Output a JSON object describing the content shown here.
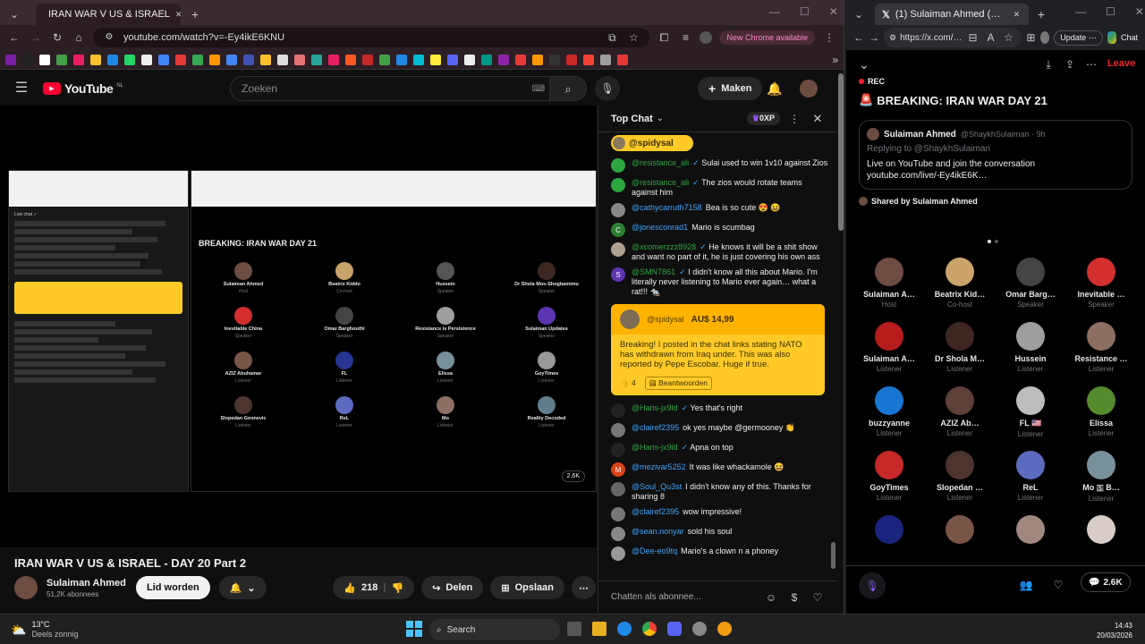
{
  "left_browser": {
    "tab_title": "IRAN WAR V US & ISRAEL",
    "url": "youtube.com/watch?v=-Ey4ikE6KNU",
    "chrome_banner": "New Chrome available"
  },
  "youtube": {
    "logo": "YouTube",
    "region": "NL",
    "search_placeholder": "Zoeken",
    "create_label": "Maken",
    "video_title": "IRAN WAR V US & ISRAEL - DAY 20 Part 2",
    "channel_name": "Sulaiman Ahmed",
    "subscribers": "51,2K abonnees",
    "join_label": "Lid worden",
    "likes": "218",
    "share_label": "Delen",
    "save_label": "Opslaan"
  },
  "video_inner": {
    "space_title": "BREAKING: IRAN WAR DAY 21",
    "speakers": [
      {
        "name": "Sulaiman Ahmed",
        "role": "Host"
      },
      {
        "name": "Beatrix Kiddo",
        "role": "Co-host"
      },
      {
        "name": "Hussein",
        "role": "Speaker"
      },
      {
        "name": "Dr Shola Mos-Shogbamimu",
        "role": "Speaker"
      },
      {
        "name": "Inevitable China",
        "role": "Speaker"
      },
      {
        "name": "Omar Barghouthi",
        "role": "Speaker"
      },
      {
        "name": "Resistance is Persistence",
        "role": "Speaker"
      },
      {
        "name": "Sulaiman Updates",
        "role": "Speaker"
      },
      {
        "name": "AZIZ Abuhamar",
        "role": "Listener"
      },
      {
        "name": "FL",
        "role": "Listener"
      },
      {
        "name": "Elissa",
        "role": "Listener"
      },
      {
        "name": "GoyTimes",
        "role": "Listener"
      },
      {
        "name": "Slopedan Geonevic",
        "role": "Listener"
      },
      {
        "name": "ReL",
        "role": "Listener"
      },
      {
        "name": "Mo",
        "role": "Listener"
      },
      {
        "name": "Reality Decoded",
        "role": "Listener"
      }
    ],
    "listeners_count": "2.6K"
  },
  "chat": {
    "mode": "Top Chat",
    "xp": "0XP",
    "pinned_user": "@spidysal",
    "messages_top": [
      {
        "user": "@resistance_ali",
        "text": "Sulai used to win 1v10 against Zios",
        "verified": true,
        "color": "#2ba640"
      },
      {
        "user": "@resistance_ali",
        "text": "The zios would rotate teams against him",
        "verified": true,
        "color": "#2ba640"
      },
      {
        "user": "@cathycarruth7158",
        "text": "Bea is so cute 😍 😆",
        "verified": false,
        "color": "#888"
      },
      {
        "user": "@jonesconrad1",
        "text": "Mario is scumbag",
        "verified": false,
        "color": "#2e7d32",
        "initial": "C"
      },
      {
        "user": "@xcomerzzz8928",
        "text": "He knows it will be a shit show and want no part of it, he is just covering his own ass",
        "verified": true,
        "color": "#b0a090"
      },
      {
        "user": "@SMN7861",
        "text": "I didn't know all this about Mario. I'm literally never listening to Mario ever again… what a rat!!! 🐀",
        "verified": true,
        "color": "#5e35b1",
        "initial": "S"
      }
    ],
    "superchat": {
      "user": "@spidysal",
      "amount": "AU$ 14,99",
      "text": "Breaking! I posted in the chat links stating NATO has withdrawn from Iraq under. This was also reported by Pepe Escobar. Huge if true.",
      "likes": "4",
      "reply_label": "Beantwoorden"
    },
    "messages_bottom": [
      {
        "user": "@Haris-jx9ld",
        "text": "Yes that's right",
        "verified": true,
        "color": "#222"
      },
      {
        "user": "@clairef2395",
        "text": "ok yes maybe @germooney 👏",
        "verified": false,
        "color": "#777"
      },
      {
        "user": "@Haris-jx9ld",
        "text": "Apna on top",
        "verified": true,
        "color": "#222"
      },
      {
        "user": "@mezivar5252",
        "text": "It was like whackamole 😆",
        "verified": false,
        "color": "#d84315",
        "initial": "M"
      },
      {
        "user": "@Soul_Qu3st",
        "text": "I didn't know any of this. Thanks for sharing 8",
        "verified": false,
        "color": "#666"
      },
      {
        "user": "@clairef2395",
        "text": "wow impressive!",
        "verified": false,
        "color": "#777"
      },
      {
        "user": "@sean.nonyar",
        "text": "sold his soul",
        "verified": false,
        "color": "#888"
      },
      {
        "user": "@Dee-eo9tq",
        "text": "Mario's a clown n a phoney",
        "verified": false,
        "color": "#999"
      }
    ],
    "input_placeholder": "Chatten als abonnee..."
  },
  "right_browser": {
    "tab_title": "(1) Sulaiman Ahmed (@ShaykhSul…",
    "url": "https://x.com/…",
    "update_label": "Update",
    "chat_label": "Chat"
  },
  "x_space": {
    "leave_label": "Leave",
    "rec_label": "REC",
    "title": "BREAKING: IRAN WAR DAY 21",
    "card_name": "Sulaiman Ahmed",
    "card_handle": "@ShaykhSulaiman · 9h",
    "card_reply": "Replying to @ShaykhSulaiman",
    "card_text_1": "Live on YouTube and join the conversation",
    "card_text_2": "youtube.com/live/-Ey4ikE6K…",
    "shared_by": "Shared by Sulaiman Ahmed",
    "participants": [
      {
        "name": "Sulaiman A…",
        "role": "Host",
        "color": "#6d4c41"
      },
      {
        "name": "Beatrix Kid…",
        "role": "Co-host",
        "color": "#c9a36a"
      },
      {
        "name": "Omar Barg…",
        "role": "Speaker",
        "color": "#444"
      },
      {
        "name": "Inevitable …",
        "role": "Speaker",
        "color": "#d32f2f"
      },
      {
        "name": "Sulaiman A…",
        "role": "Listener",
        "color": "#b71c1c"
      },
      {
        "name": "Dr Shola M…",
        "role": "Listener",
        "color": "#3e2723"
      },
      {
        "name": "Hussein",
        "role": "Listener",
        "color": "#9e9e9e"
      },
      {
        "name": "Resistance …",
        "role": "Listener",
        "color": "#8d6e63"
      },
      {
        "name": "buzzyanne",
        "role": "Listener",
        "color": "#1976d2"
      },
      {
        "name": "AZIZ Ab…",
        "role": "Listener",
        "color": "#5d4037"
      },
      {
        "name": "FL 🇺🇸",
        "role": "Listener",
        "color": "#bdbdbd"
      },
      {
        "name": "Elissa",
        "role": "Listener",
        "color": "#558b2f"
      },
      {
        "name": "GoyTimes",
        "role": "Listener",
        "color": "#c62828"
      },
      {
        "name": "Slopedan …",
        "role": "Listener",
        "color": "#4e342e"
      },
      {
        "name": "ReL",
        "role": "Listener",
        "color": "#5c6bc0"
      },
      {
        "name": "Mo 🇸 B…",
        "role": "Listener",
        "color": "#78909c"
      },
      {
        "name": "",
        "role": "",
        "color": "#1a237e"
      },
      {
        "name": "",
        "role": "",
        "color": "#795548"
      },
      {
        "name": "",
        "role": "",
        "color": "#a1887f"
      },
      {
        "name": "",
        "role": "",
        "color": "#d7ccc8"
      }
    ],
    "listeners_count": "2.6K"
  },
  "taskbar": {
    "weather_temp": "13°C",
    "weather_desc": "Deels zonnig",
    "search_label": "Search",
    "time": "14:43",
    "date": "20/03/2026"
  },
  "colors": {
    "accent_red": "#ff0033",
    "superchat": "#ffca28",
    "x_leave": "#f4212e",
    "yt_blue": "#3ea6ff"
  }
}
